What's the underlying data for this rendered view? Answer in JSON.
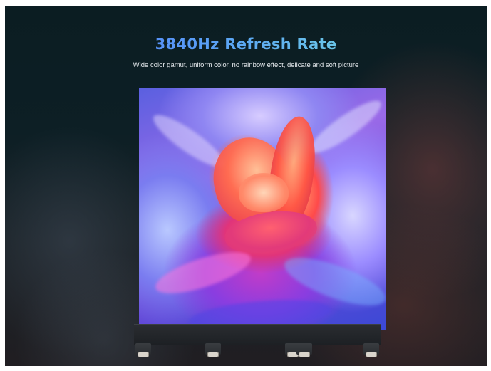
{
  "hero": {
    "title": "3840Hz Refresh Rate",
    "subtitle": "Wide color gamut, uniform color, no rainbow effect, delicate and soft picture"
  },
  "colors": {
    "title_gradient_start": "#4f6bff",
    "title_gradient_end": "#7ef0d6",
    "background": "#0d1f25",
    "subtitle": "#e6eaee"
  },
  "images": {
    "display_panel": "flower-artwork-image",
    "stand": "led-cabinet-stand-image"
  }
}
